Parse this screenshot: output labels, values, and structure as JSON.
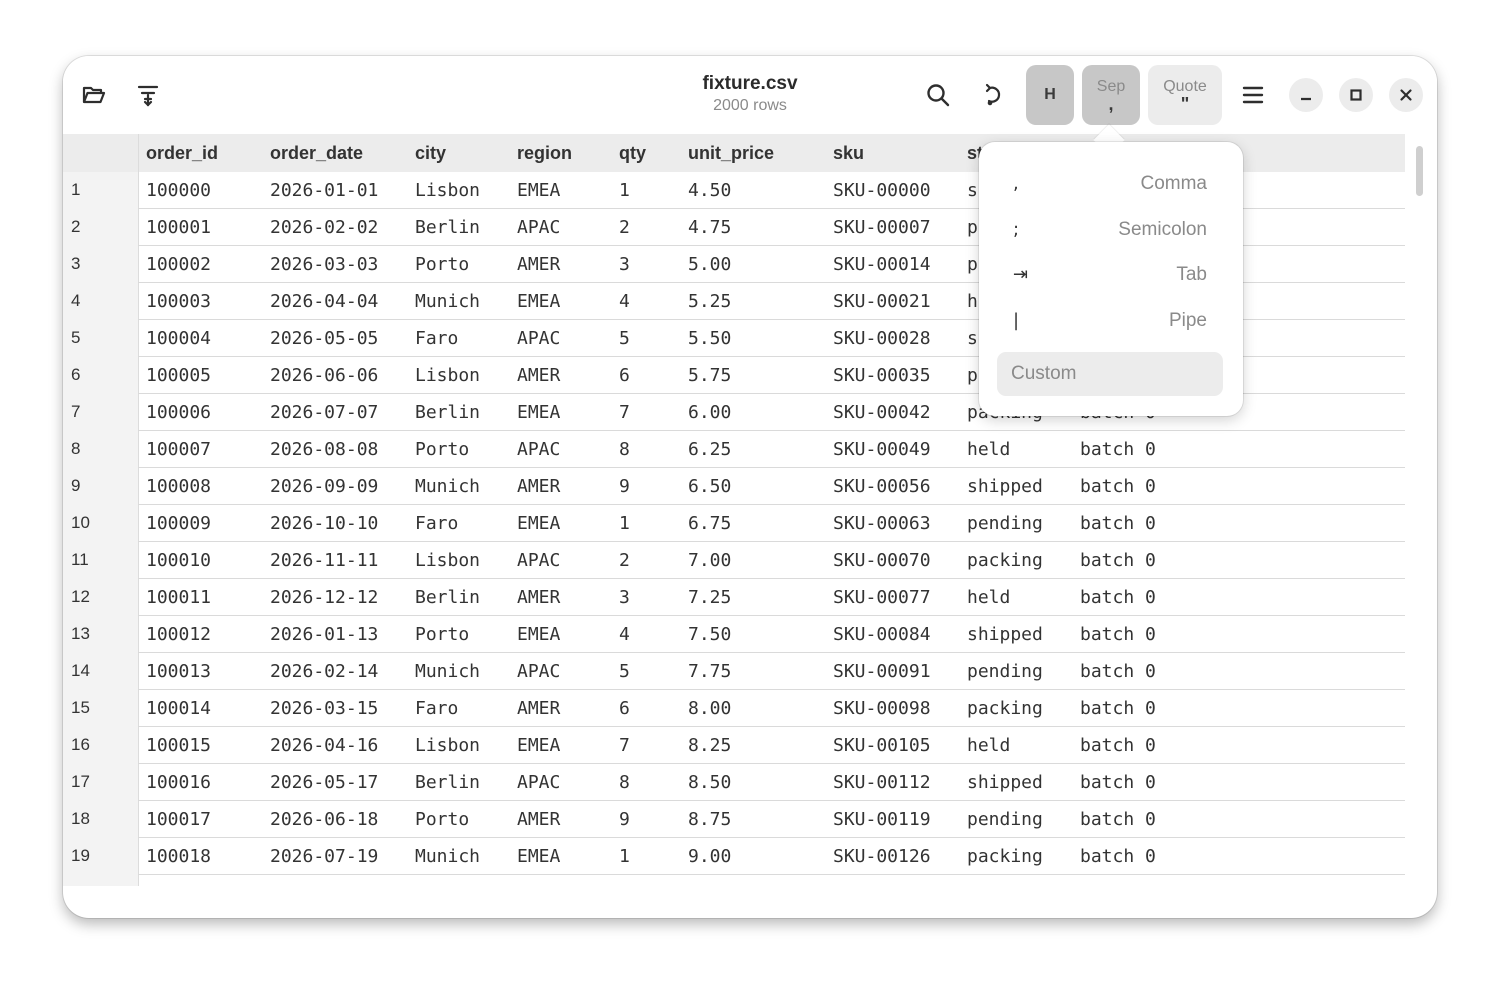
{
  "header": {
    "title": "fixture.csv",
    "subtitle": "2000 rows",
    "toggles": {
      "header_label": "H",
      "sep_label": "Sep",
      "sep_value": ",",
      "quote_label": "Quote",
      "quote_value": "\""
    },
    "icons": [
      "folder-open-icon",
      "filter-icon",
      "search-icon",
      "rotate-icon",
      "menu-icon",
      "minimize-icon",
      "maximize-icon",
      "close-icon"
    ]
  },
  "table": {
    "columns": [
      "order_id",
      "order_date",
      "city",
      "region",
      "qty",
      "unit_price",
      "sku",
      "st",
      ""
    ],
    "rows": [
      [
        "1",
        "100000",
        "2026-01-01",
        "Lisbon",
        "EMEA",
        "1",
        "4.50",
        "SKU-00000",
        "s",
        ""
      ],
      [
        "2",
        "100001",
        "2026-02-02",
        "Berlin",
        "APAC",
        "2",
        "4.75",
        "SKU-00007",
        "p",
        ""
      ],
      [
        "3",
        "100002",
        "2026-03-03",
        "Porto",
        "AMER",
        "3",
        "5.00",
        "SKU-00014",
        "p",
        ""
      ],
      [
        "4",
        "100003",
        "2026-04-04",
        "Munich",
        "EMEA",
        "4",
        "5.25",
        "SKU-00021",
        "h",
        ""
      ],
      [
        "5",
        "100004",
        "2026-05-05",
        "Faro",
        "APAC",
        "5",
        "5.50",
        "SKU-00028",
        "s",
        ""
      ],
      [
        "6",
        "100005",
        "2026-06-06",
        "Lisbon",
        "AMER",
        "6",
        "5.75",
        "SKU-00035",
        "p",
        ""
      ],
      [
        "7",
        "100006",
        "2026-07-07",
        "Berlin",
        "EMEA",
        "7",
        "6.00",
        "SKU-00042",
        "packing",
        "batch 0"
      ],
      [
        "8",
        "100007",
        "2026-08-08",
        "Porto",
        "APAC",
        "8",
        "6.25",
        "SKU-00049",
        "held",
        "batch 0"
      ],
      [
        "9",
        "100008",
        "2026-09-09",
        "Munich",
        "AMER",
        "9",
        "6.50",
        "SKU-00056",
        "shipped",
        "batch 0"
      ],
      [
        "10",
        "100009",
        "2026-10-10",
        "Faro",
        "EMEA",
        "1",
        "6.75",
        "SKU-00063",
        "pending",
        "batch 0"
      ],
      [
        "11",
        "100010",
        "2026-11-11",
        "Lisbon",
        "APAC",
        "2",
        "7.00",
        "SKU-00070",
        "packing",
        "batch 0"
      ],
      [
        "12",
        "100011",
        "2026-12-12",
        "Berlin",
        "AMER",
        "3",
        "7.25",
        "SKU-00077",
        "held",
        "batch 0"
      ],
      [
        "13",
        "100012",
        "2026-01-13",
        "Porto",
        "EMEA",
        "4",
        "7.50",
        "SKU-00084",
        "shipped",
        "batch 0"
      ],
      [
        "14",
        "100013",
        "2026-02-14",
        "Munich",
        "APAC",
        "5",
        "7.75",
        "SKU-00091",
        "pending",
        "batch 0"
      ],
      [
        "15",
        "100014",
        "2026-03-15",
        "Faro",
        "AMER",
        "6",
        "8.00",
        "SKU-00098",
        "packing",
        "batch 0"
      ],
      [
        "16",
        "100015",
        "2026-04-16",
        "Lisbon",
        "EMEA",
        "7",
        "8.25",
        "SKU-00105",
        "held",
        "batch 0"
      ],
      [
        "17",
        "100016",
        "2026-05-17",
        "Berlin",
        "APAC",
        "8",
        "8.50",
        "SKU-00112",
        "shipped",
        "batch 0"
      ],
      [
        "18",
        "100017",
        "2026-06-18",
        "Porto",
        "AMER",
        "9",
        "8.75",
        "SKU-00119",
        "pending",
        "batch 0"
      ],
      [
        "19",
        "100018",
        "2026-07-19",
        "Munich",
        "EMEA",
        "1",
        "9.00",
        "SKU-00126",
        "packing",
        "batch 0"
      ]
    ]
  },
  "separator_popover": {
    "items": [
      {
        "glyph": ",",
        "label": "Comma"
      },
      {
        "glyph": ";",
        "label": "Semicolon"
      },
      {
        "glyph": "⇥",
        "label": "Tab"
      },
      {
        "glyph": "|",
        "label": "Pipe"
      }
    ],
    "custom_placeholder": "Custom"
  },
  "colors": {
    "toggle_active": "#c7c7c7",
    "toggle_inactive": "#ececec",
    "header_row_bg": "#ececec"
  }
}
